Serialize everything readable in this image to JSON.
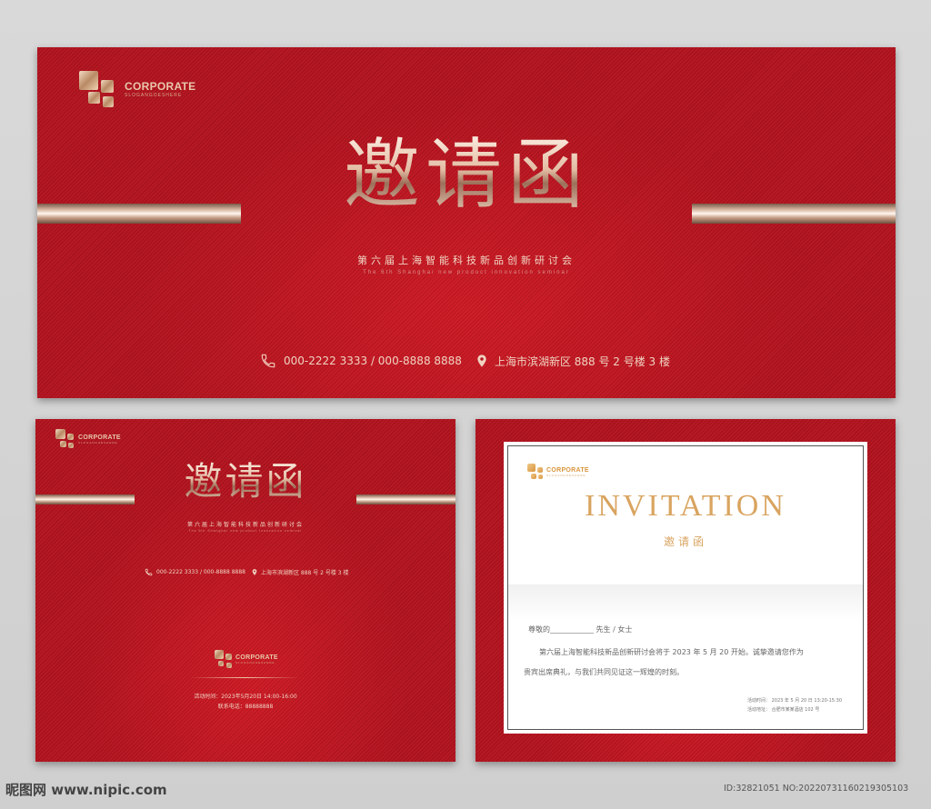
{
  "banner": {
    "logo_text": "CORPORATE",
    "logo_sub": "SLOGANGOESHERE",
    "title": "邀请函",
    "subtitle": "第六届上海智能科技新品创新研讨会",
    "subtitle_en": "The 6th Shanghai new product innovation seminar",
    "phone": "000-2222 3333  /  000-8888 8888",
    "address": "上海市滨湖新区 888 号 2 号楼 3 楼"
  },
  "card_left": {
    "logo_text": "CORPORATE",
    "logo_sub": "SLOGANGOESHERE",
    "title": "邀请函",
    "subtitle": "第六届上海智能科技新品创新研讨会",
    "subtitle_en": "The 6th Shanghai new product innovation seminar",
    "phone": "000-2222 3333  /  000-8888 8888",
    "address": "上海市滨湖新区 888 号 2 号楼 3 楼",
    "footer_logo": "CORPORATE",
    "footer_logo_sub": "SLOGANGOESHERE",
    "event_time": "活动时间：2023年5月20日 14:00-16:00",
    "contact_phone": "联系电话：88888888"
  },
  "card_right": {
    "logo_text": "CORPORATE",
    "logo_sub": "SLOGANGOESHERE",
    "title_en": "INVITATION",
    "title_cn": "邀请函",
    "salutation": "尊敬的____________  先生 / 女士",
    "body_line1": "第六届上海智能科技新品创新研讨会将于 2023 年 5 月 20 开始。诚挚邀请您作为",
    "body_line2": "贵宾出席典礼，与我们共同见证这一辉煌的时刻。",
    "detail_time": "活动时间：  2023 年 5 月 20 日 13:20-15:30",
    "detail_place": "活动地址：  合肥市某某酒店 102 号"
  },
  "watermark": {
    "left": "昵图网 www.nipic.com",
    "right": "ID:32821051 NO:20220731160219305103"
  },
  "colors": {
    "panel_red": "#b3121d",
    "gold": "#e3bca3",
    "invitation_gold": "#d9a460"
  },
  "icons": [
    "logo-mark-icon",
    "phone-icon",
    "location-pin-icon"
  ]
}
